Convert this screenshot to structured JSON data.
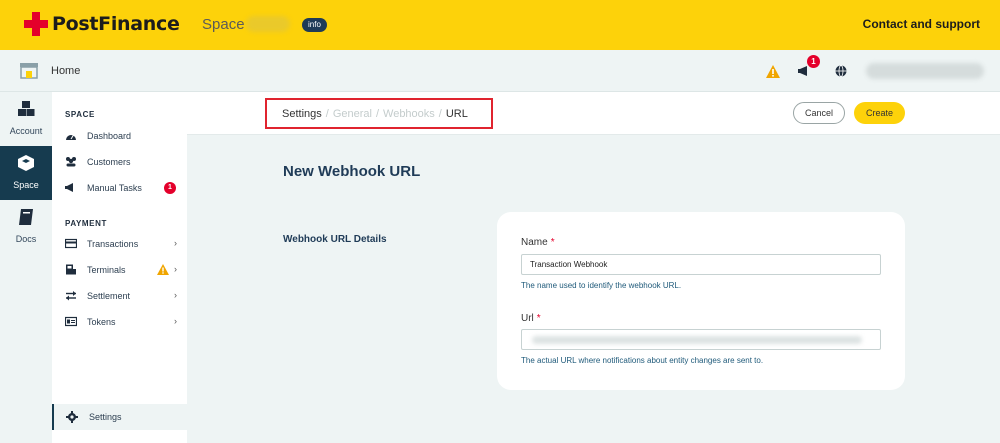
{
  "header": {
    "brand": "PostFinance",
    "space_label": "Space",
    "info_badge": "info",
    "contact_link": "Contact and support"
  },
  "subbar": {
    "home_label": "Home",
    "notification_count": "1"
  },
  "rail": {
    "items": [
      {
        "label": "Account",
        "icon": "cubes-icon"
      },
      {
        "label": "Space",
        "icon": "cube-icon",
        "active": true
      },
      {
        "label": "Docs",
        "icon": "book-icon"
      }
    ]
  },
  "sidebar": {
    "space_title": "SPACE",
    "space_items": [
      {
        "label": "Dashboard",
        "icon": "dashboard-icon"
      },
      {
        "label": "Customers",
        "icon": "users-icon"
      },
      {
        "label": "Manual Tasks",
        "icon": "megaphone-icon",
        "badge": "1"
      }
    ],
    "payment_title": "PAYMENT",
    "payment_items": [
      {
        "label": "Transactions",
        "icon": "card-icon"
      },
      {
        "label": "Terminals",
        "icon": "terminal-icon",
        "warning": true
      },
      {
        "label": "Settlement",
        "icon": "exchange-icon"
      },
      {
        "label": "Tokens",
        "icon": "id-card-icon"
      }
    ],
    "settings_label": "Settings",
    "chevron": "›"
  },
  "breadcrumb": {
    "items": [
      "Settings",
      "General",
      "Webhooks",
      "URL"
    ],
    "separator": "/"
  },
  "actions": {
    "cancel_label": "Cancel",
    "create_label": "Create"
  },
  "main": {
    "title": "New Webhook URL",
    "section_label": "Webhook URL Details",
    "name_label": "Name",
    "name_value": "Transaction Webhook",
    "name_helper": "The name used to identify the webhook URL.",
    "url_label": "Url",
    "url_value": "",
    "url_helper": "The actual URL where notifications about entity changes are sent to.",
    "required_mark": "*"
  },
  "colors": {
    "brand_yellow": "#fdd20a",
    "brand_red": "#e4002b",
    "dark_navy": "#163b4f"
  }
}
